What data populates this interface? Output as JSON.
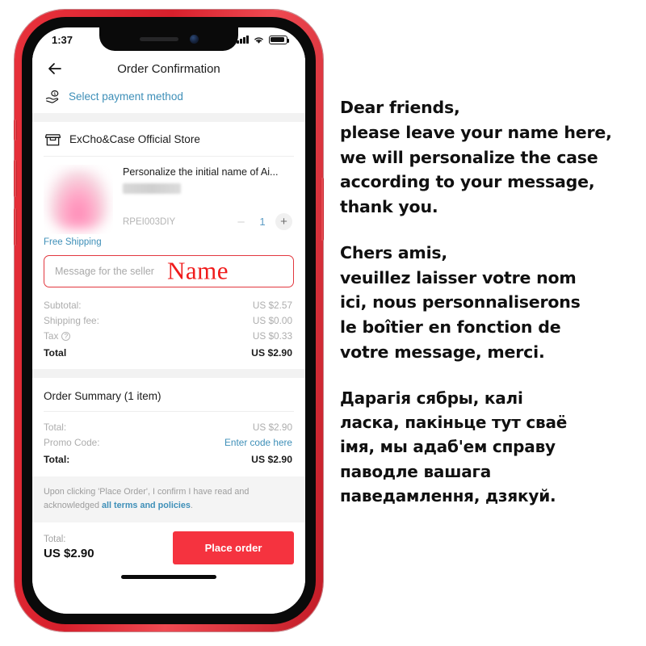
{
  "phone": {
    "status_bar": {
      "time": "1:37",
      "signal_icon": "signal-bars-icon",
      "wifi_icon": "wifi-icon",
      "battery_icon": "battery-full-icon"
    },
    "navbar": {
      "back_icon": "back-arrow-icon",
      "title": "Order Confirmation"
    },
    "payment": {
      "icon": "hand-money-icon",
      "label": "Select payment method"
    },
    "store": {
      "icon": "storefront-icon",
      "name": "ExCho&Case Official Store"
    },
    "product": {
      "title": "Personalize the initial name of Ai...",
      "sku": "RPEI003DIY",
      "quantity": "1",
      "minus_label": "–",
      "plus_label": "+",
      "shipping_label": "Free Shipping",
      "thumb_alt": "blurred-pink-airpods-case"
    },
    "message_box": {
      "placeholder": "Message for the seller",
      "overlay_text": "Name",
      "border_color": "#e2383f",
      "overlay_color": "#f01b1b"
    },
    "totals": [
      {
        "label": "Subtotal:",
        "value": "US $2.57",
        "bold": false
      },
      {
        "label": "Shipping fee:",
        "value": "US $0.00",
        "bold": false
      },
      {
        "label": "Tax",
        "value": "US $0.33",
        "bold": false,
        "has_help_icon": true
      },
      {
        "label": "Total",
        "value": "US $2.90",
        "bold": true
      }
    ],
    "order_summary": {
      "heading": "Order Summary (1 item)",
      "rows": [
        {
          "label": "Total:",
          "value": "US $2.90",
          "bold": false,
          "link": false
        },
        {
          "label": "Promo Code:",
          "value": "Enter code here",
          "bold": false,
          "link": true
        },
        {
          "label": "Total:",
          "value": "US $2.90",
          "bold": true,
          "link": false
        }
      ]
    },
    "terms": {
      "prefix": "Upon clicking 'Place Order', I confirm I have read and acknowledged ",
      "link": "all terms and policies",
      "suffix": "."
    },
    "checkout": {
      "total_label": "Total:",
      "total_value": "US $2.90",
      "button_label": "Place order",
      "button_color": "#f5333f"
    }
  },
  "panel": {
    "english": "Dear friends,\nplease leave your name here,\nwe will personalize the case\naccording to your message,\nthank you.",
    "french": "Chers amis,\nveuillez laisser votre nom\nici, nous personnaliserons\nle boîtier en fonction de\nvotre message, merci.",
    "belarusian": "Дарагія сябры, калі\nласка, пакіньце тут сваё\nімя, мы адаб'ем справу\nпаводле вашага\nпаведамлення, дзякуй."
  }
}
